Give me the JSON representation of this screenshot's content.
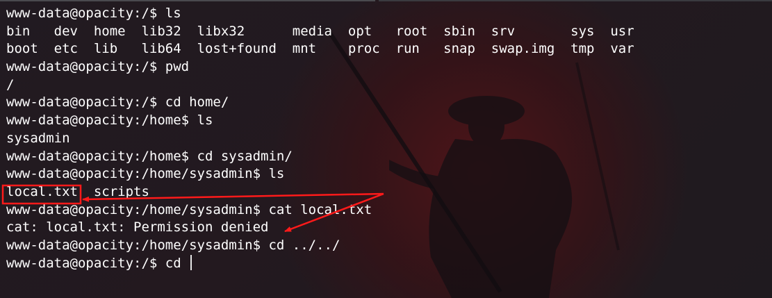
{
  "terminal": {
    "lines": [
      "www-data@opacity:/$ ls",
      "bin   dev  home  lib32  libx32      media  opt   root  sbin  srv       sys  usr",
      "boot  etc  lib   lib64  lost+found  mnt    proc  run   snap  swap.img  tmp  var",
      "www-data@opacity:/$ pwd",
      "/",
      "www-data@opacity:/$ cd home/",
      "www-data@opacity:/home$ ls",
      "sysadmin",
      "www-data@opacity:/home$ cd sysadmin/",
      "www-data@opacity:/home/sysadmin$ ls",
      "local.txt  scripts",
      "www-data@opacity:/home/sysadmin$ cat local.txt",
      "cat: local.txt: Permission denied",
      "www-data@opacity:/home/sysadmin$ cd ../../",
      "www-data@opacity:/$ cd "
    ]
  },
  "annotation": {
    "highlight_color": "#ff1a1a"
  },
  "colors": {
    "background": "#221a20",
    "text": "#ffffff",
    "accent_red": "#ff1a1a"
  }
}
